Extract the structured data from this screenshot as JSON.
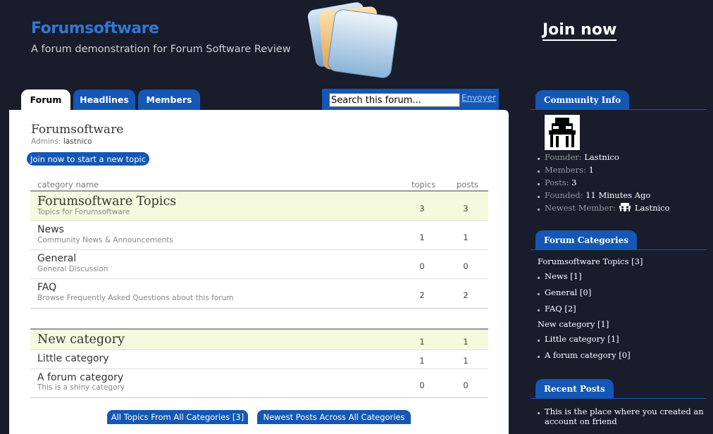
{
  "header": {
    "site_title": "Forumsoftware",
    "tagline": "A forum demonstration for Forum Software Review",
    "join_label": "Join now"
  },
  "tabs": [
    {
      "label": "Forum",
      "active": true
    },
    {
      "label": "Headlines",
      "active": false
    },
    {
      "label": "Members",
      "active": false
    }
  ],
  "search": {
    "value": "Search this forum...",
    "submit_label": "Envoyer"
  },
  "forum": {
    "name": "Forumsoftware",
    "admins_label": "Admins:",
    "admins_value": "lastnico",
    "new_topic_label": "Join now to start a new topic"
  },
  "table": {
    "col_category": "category name",
    "col_topics": "topics",
    "col_posts": "posts",
    "groups": [
      {
        "name": "Forumsoftware Topics",
        "desc": "Topics for Forumsoftware",
        "topics": "3",
        "posts": "3",
        "items": [
          {
            "name": "News",
            "desc": "Community News & Announcements",
            "topics": "1",
            "posts": "1"
          },
          {
            "name": "General",
            "desc": "General Discussion",
            "topics": "0",
            "posts": "0"
          },
          {
            "name": "FAQ",
            "desc": "Browse Frequently Asked Questions about this forum",
            "topics": "2",
            "posts": "2"
          }
        ]
      },
      {
        "name": "New category",
        "desc": "",
        "topics": "1",
        "posts": "1",
        "items": [
          {
            "name": "Little category",
            "desc": "",
            "topics": "1",
            "posts": "1"
          },
          {
            "name": "A forum category",
            "desc": "This is a shiny category",
            "topics": "0",
            "posts": "0"
          }
        ]
      }
    ]
  },
  "bottom_buttons": {
    "all_topics": "All Topics From All Categories [3]",
    "newest_posts": "Newest Posts Across All Categories"
  },
  "sidebar": {
    "community_heading": "Community Info",
    "founder_label": "Founder:",
    "founder_value": "Lastnico",
    "members_label": "Members:",
    "members_value": "1",
    "posts_label": "Posts:",
    "posts_value": "3",
    "founded_label": "Founded:",
    "founded_value": "11 Minutes Ago",
    "newest_label": "Newest Member:",
    "newest_value": "Lastnico",
    "categories_heading": "Forum Categories",
    "cat_group1": "Forumsoftware Topics [3]",
    "cat_items1": [
      "News [1]",
      "General [0]",
      "FAQ [2]"
    ],
    "cat_group2": "New category [1]",
    "cat_items2": [
      "Little category [1]",
      "A forum category [0]"
    ],
    "recent_heading": "Recent Posts",
    "recent_line1": "This is the place where you created an",
    "recent_line2": "account on friend"
  },
  "colors": {
    "background": "#181c2b",
    "accent": "#1457b5",
    "title_blue": "#2f78d6",
    "category_row": "#f5fadf"
  }
}
